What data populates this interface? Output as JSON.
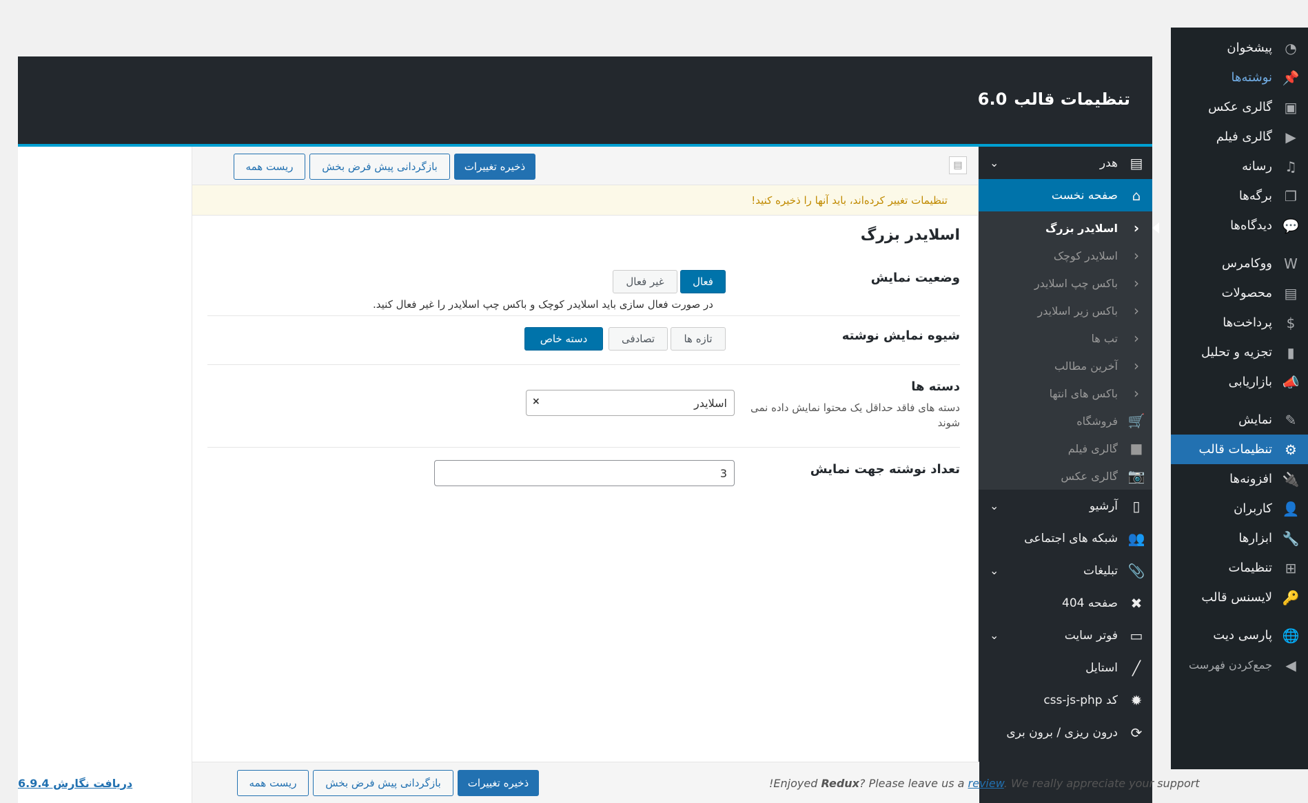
{
  "wp_menu": {
    "items": [
      {
        "label": "پیشخوان",
        "icon": "dashboard-icon",
        "glyph": "◔"
      },
      {
        "label": "نوشته‌ها",
        "icon": "pin-icon",
        "glyph": "📌"
      },
      {
        "label": "گالری عکس",
        "icon": "image-gallery-icon",
        "glyph": "▣"
      },
      {
        "label": "گالری فیلم",
        "icon": "video-icon",
        "glyph": "▶"
      },
      {
        "label": "رسانه",
        "icon": "media-icon",
        "glyph": "♫"
      },
      {
        "label": "برگه‌ها",
        "icon": "pages-icon",
        "glyph": "❐"
      },
      {
        "label": "دیدگاه‌ها",
        "icon": "comments-icon",
        "glyph": "💬"
      },
      {
        "label": "ووکامرس",
        "icon": "woocommerce-icon",
        "glyph": "W"
      },
      {
        "label": "محصولات",
        "icon": "products-icon",
        "glyph": "▤"
      },
      {
        "label": "پرداخت‌ها",
        "icon": "payments-icon",
        "glyph": "$"
      },
      {
        "label": "تجزیه و تحلیل",
        "icon": "analytics-icon",
        "glyph": "▮"
      },
      {
        "label": "بازاریابی",
        "icon": "megaphone-icon",
        "glyph": "📣"
      },
      {
        "label": "نمایش",
        "icon": "appearance-icon",
        "glyph": "✎"
      },
      {
        "label": "تنظیمات قالب",
        "icon": "gear-icon",
        "glyph": "⚙"
      },
      {
        "label": "افزونه‌ها",
        "icon": "plugins-icon",
        "glyph": "🔌"
      },
      {
        "label": "کاربران",
        "icon": "users-icon",
        "glyph": "👤"
      },
      {
        "label": "ابزارها",
        "icon": "tools-icon",
        "glyph": "🔧"
      },
      {
        "label": "تنظیمات",
        "icon": "settings-icon",
        "glyph": "⊞"
      },
      {
        "label": "لایسنس قالب",
        "icon": "key-icon",
        "glyph": "🔑"
      },
      {
        "label": "پارسی دیت",
        "icon": "globe-icon",
        "glyph": "🌐"
      },
      {
        "label": "جمع‌کردن فهرست",
        "icon": "collapse-icon",
        "glyph": "◀"
      }
    ]
  },
  "header": {
    "title": "تنظیمات قالب",
    "version": "6.0"
  },
  "redux_sidebar": {
    "sections": [
      {
        "label": "هدر",
        "icon": "header-layout-icon",
        "glyph": "▤",
        "has_arrow": true
      },
      {
        "label": "صفحه نخست",
        "icon": "home-icon",
        "glyph": "⌂",
        "active": true
      }
    ],
    "subitems": [
      {
        "label": "اسلایدر بزرگ",
        "icon": "chevron-left-icon",
        "glyph": "‹",
        "active": true
      },
      {
        "label": "اسلایدر کوچک",
        "icon": "chevron-left-icon",
        "glyph": "‹"
      },
      {
        "label": "باکس چپ اسلایدر",
        "icon": "chevron-left-icon",
        "glyph": "‹"
      },
      {
        "label": "باکس زیر اسلایدر",
        "icon": "chevron-left-icon",
        "glyph": "‹"
      },
      {
        "label": "تب ها",
        "icon": "chevron-left-icon",
        "glyph": "‹"
      },
      {
        "label": "آخرین مطالب",
        "icon": "chevron-left-icon",
        "glyph": "‹"
      },
      {
        "label": "باکس های انتها",
        "icon": "chevron-left-icon",
        "glyph": "‹"
      },
      {
        "label": "فروشگاه",
        "icon": "cart-icon",
        "glyph": "🛒"
      },
      {
        "label": "گالری فیلم",
        "icon": "video-camera-icon",
        "glyph": "■"
      },
      {
        "label": "گالری عکس",
        "icon": "camera-icon",
        "glyph": "📷"
      }
    ],
    "sections_after": [
      {
        "label": "آرشیو",
        "icon": "archive-icon",
        "glyph": "▯",
        "has_arrow": true
      },
      {
        "label": "شبکه های اجتماعی",
        "icon": "group-icon",
        "glyph": "👥"
      },
      {
        "label": "تبلیغات",
        "icon": "paperclip-icon",
        "glyph": "📎",
        "has_arrow": true
      },
      {
        "label": "صفحه 404",
        "icon": "x-icon",
        "glyph": "✖"
      },
      {
        "label": "فوتر سایت",
        "icon": "laptop-icon",
        "glyph": "▭",
        "has_arrow": true
      },
      {
        "label": "استایل",
        "icon": "brush-icon",
        "glyph": "╱"
      },
      {
        "label": "کد css-js-php",
        "icon": "cog-icon",
        "glyph": "✹"
      },
      {
        "label": "درون ریزی / برون بری",
        "icon": "refresh-icon",
        "glyph": "⟳"
      }
    ]
  },
  "toolbar": {
    "save_label": "ذخیره تغییرات",
    "reset_section_label": "بازگردانی پیش فرض بخش",
    "reset_all_label": "ریست همه"
  },
  "notice": "تنظیمات تغییر کرده‌اند، باید آنها را ذخیره کنید!",
  "section": {
    "title": "اسلایدر بزرگ",
    "display_status": {
      "label": "وضعیت نمایش",
      "on_label": "فعال",
      "off_label": "غیر فعال",
      "selected": "فعال",
      "note": "در صورت فعال سازی باید اسلایدر کوچک و باکس چپ اسلایدر را غیر فعال کنید."
    },
    "display_mode": {
      "label": "شیوه نمایش نوشته",
      "options": [
        "تازه ها",
        "تصادفی",
        "دسته خاص"
      ],
      "selected": "دسته خاص"
    },
    "categories": {
      "label": "دسته ها",
      "desc": "دسته های فاقد حداقل یک محتوا نمایش داده نمی شوند",
      "value": "اسلایدر",
      "clear": "×"
    },
    "post_count": {
      "label": "تعداد نوشته جهت نمایش",
      "value": "3"
    }
  },
  "footer": {
    "credit_pre": "!Enjoyed ",
    "credit_brand": "Redux",
    "credit_mid": "? Please leave us a ",
    "credit_link": "review",
    "credit_post": ". We really appreciate your support",
    "version_text": "دریافت نگارش 6.9.4"
  }
}
